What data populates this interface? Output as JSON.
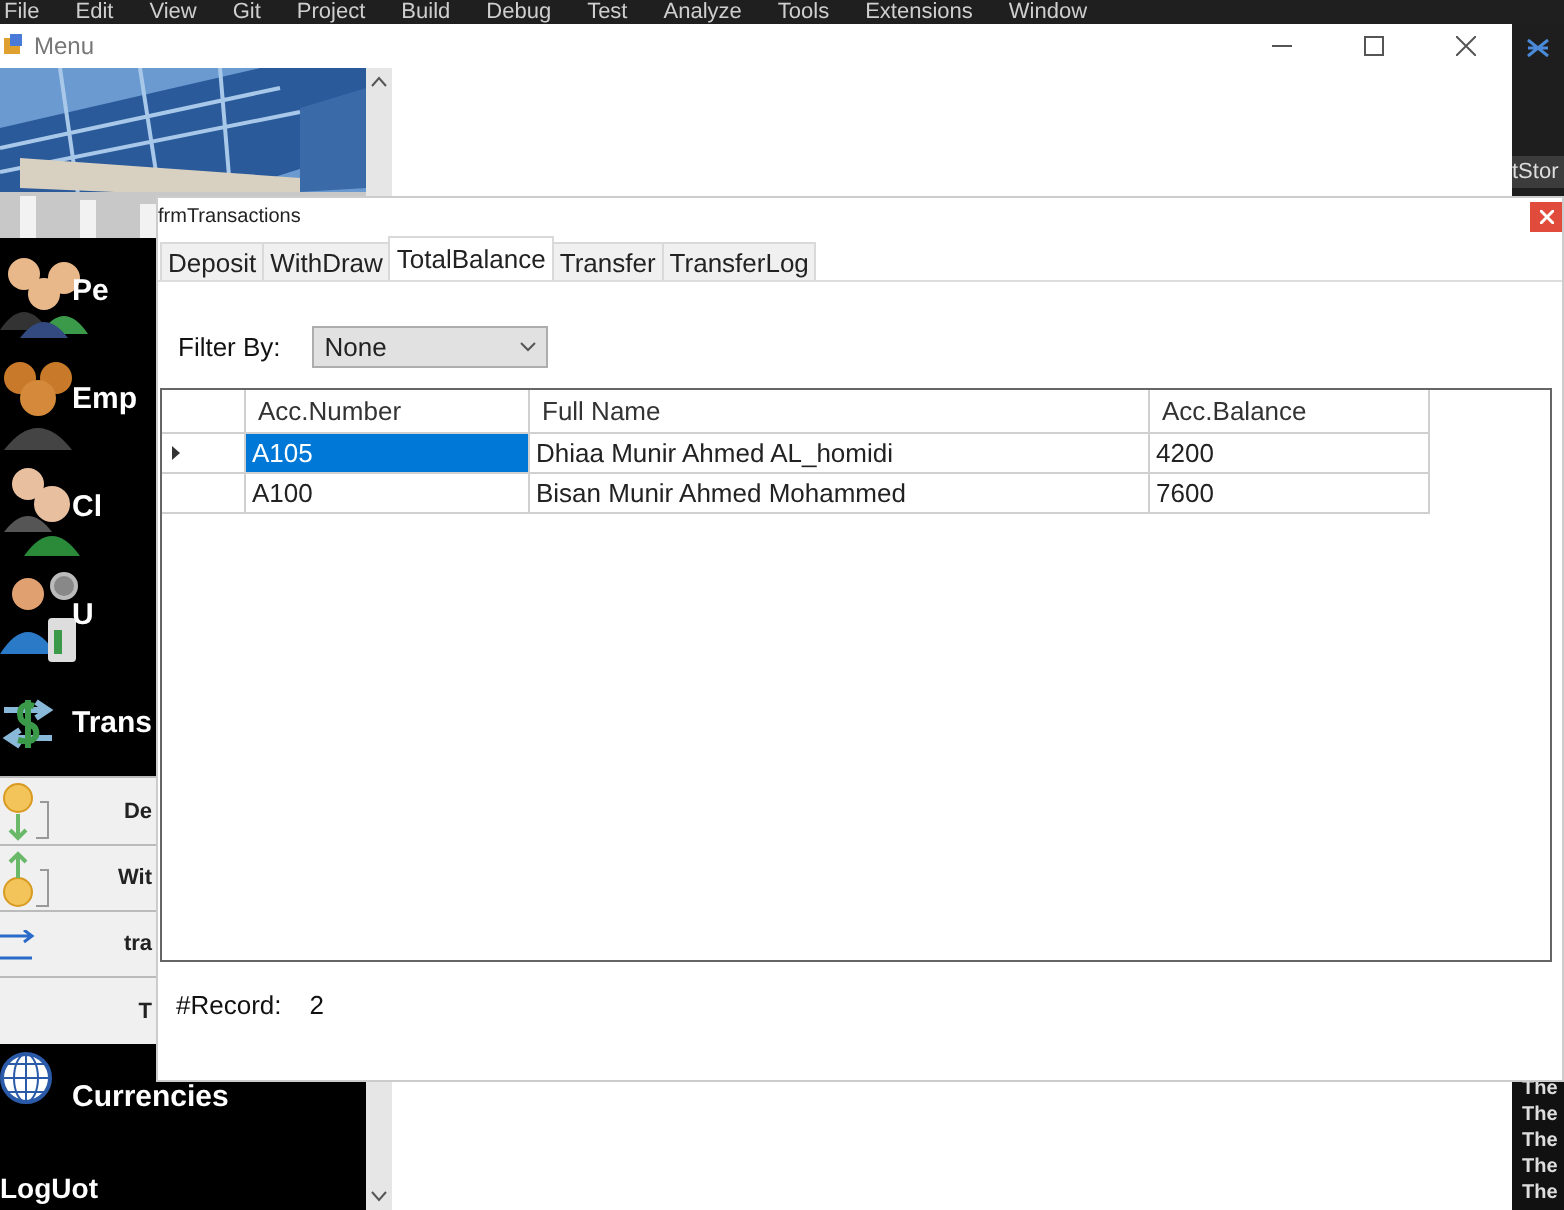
{
  "ide_menu": [
    "File",
    "Edit",
    "View",
    "Git",
    "Project",
    "Build",
    "Debug",
    "Test",
    "Analyze",
    "Tools",
    "Extensions",
    "Window"
  ],
  "ide_side": {
    "tab": "tStor",
    "output_lines": [
      "The",
      "The",
      "The",
      "The",
      "The"
    ]
  },
  "menu_window": {
    "title": "Menu",
    "sidebar": {
      "items": [
        {
          "label": "Pe",
          "kind": "main"
        },
        {
          "label": "Emp",
          "kind": "main"
        },
        {
          "label": "Cl",
          "kind": "main"
        },
        {
          "label": "U",
          "kind": "main"
        },
        {
          "label": "Trans",
          "kind": "main"
        },
        {
          "label": "De",
          "kind": "sub"
        },
        {
          "label": "Wit",
          "kind": "sub"
        },
        {
          "label": "tra",
          "kind": "sub"
        },
        {
          "label": "T",
          "kind": "sub"
        },
        {
          "label": "Currencies",
          "kind": "main"
        },
        {
          "label": "LogUot",
          "kind": "footer"
        }
      ]
    }
  },
  "dialog": {
    "title": "frmTransactions",
    "tabs": [
      {
        "label": "Deposit",
        "selected": false
      },
      {
        "label": "WithDraw",
        "selected": false
      },
      {
        "label": "TotalBalance",
        "selected": true
      },
      {
        "label": "Transfer",
        "selected": false
      },
      {
        "label": "TransferLog",
        "selected": false
      }
    ],
    "filter": {
      "label": "Filter By:",
      "value": "None"
    },
    "table": {
      "columns": [
        "Acc.Number",
        "Full Name",
        "Acc.Balance"
      ],
      "rows": [
        {
          "cells": [
            "A105",
            "Dhiaa Munir Ahmed AL_homidi",
            "4200"
          ],
          "current": true,
          "selected": true
        },
        {
          "cells": [
            "A100",
            "Bisan Munir Ahmed Mohammed",
            "7600"
          ],
          "current": false,
          "selected": false
        }
      ]
    },
    "record": {
      "label": "#Record:",
      "value": "2"
    }
  }
}
